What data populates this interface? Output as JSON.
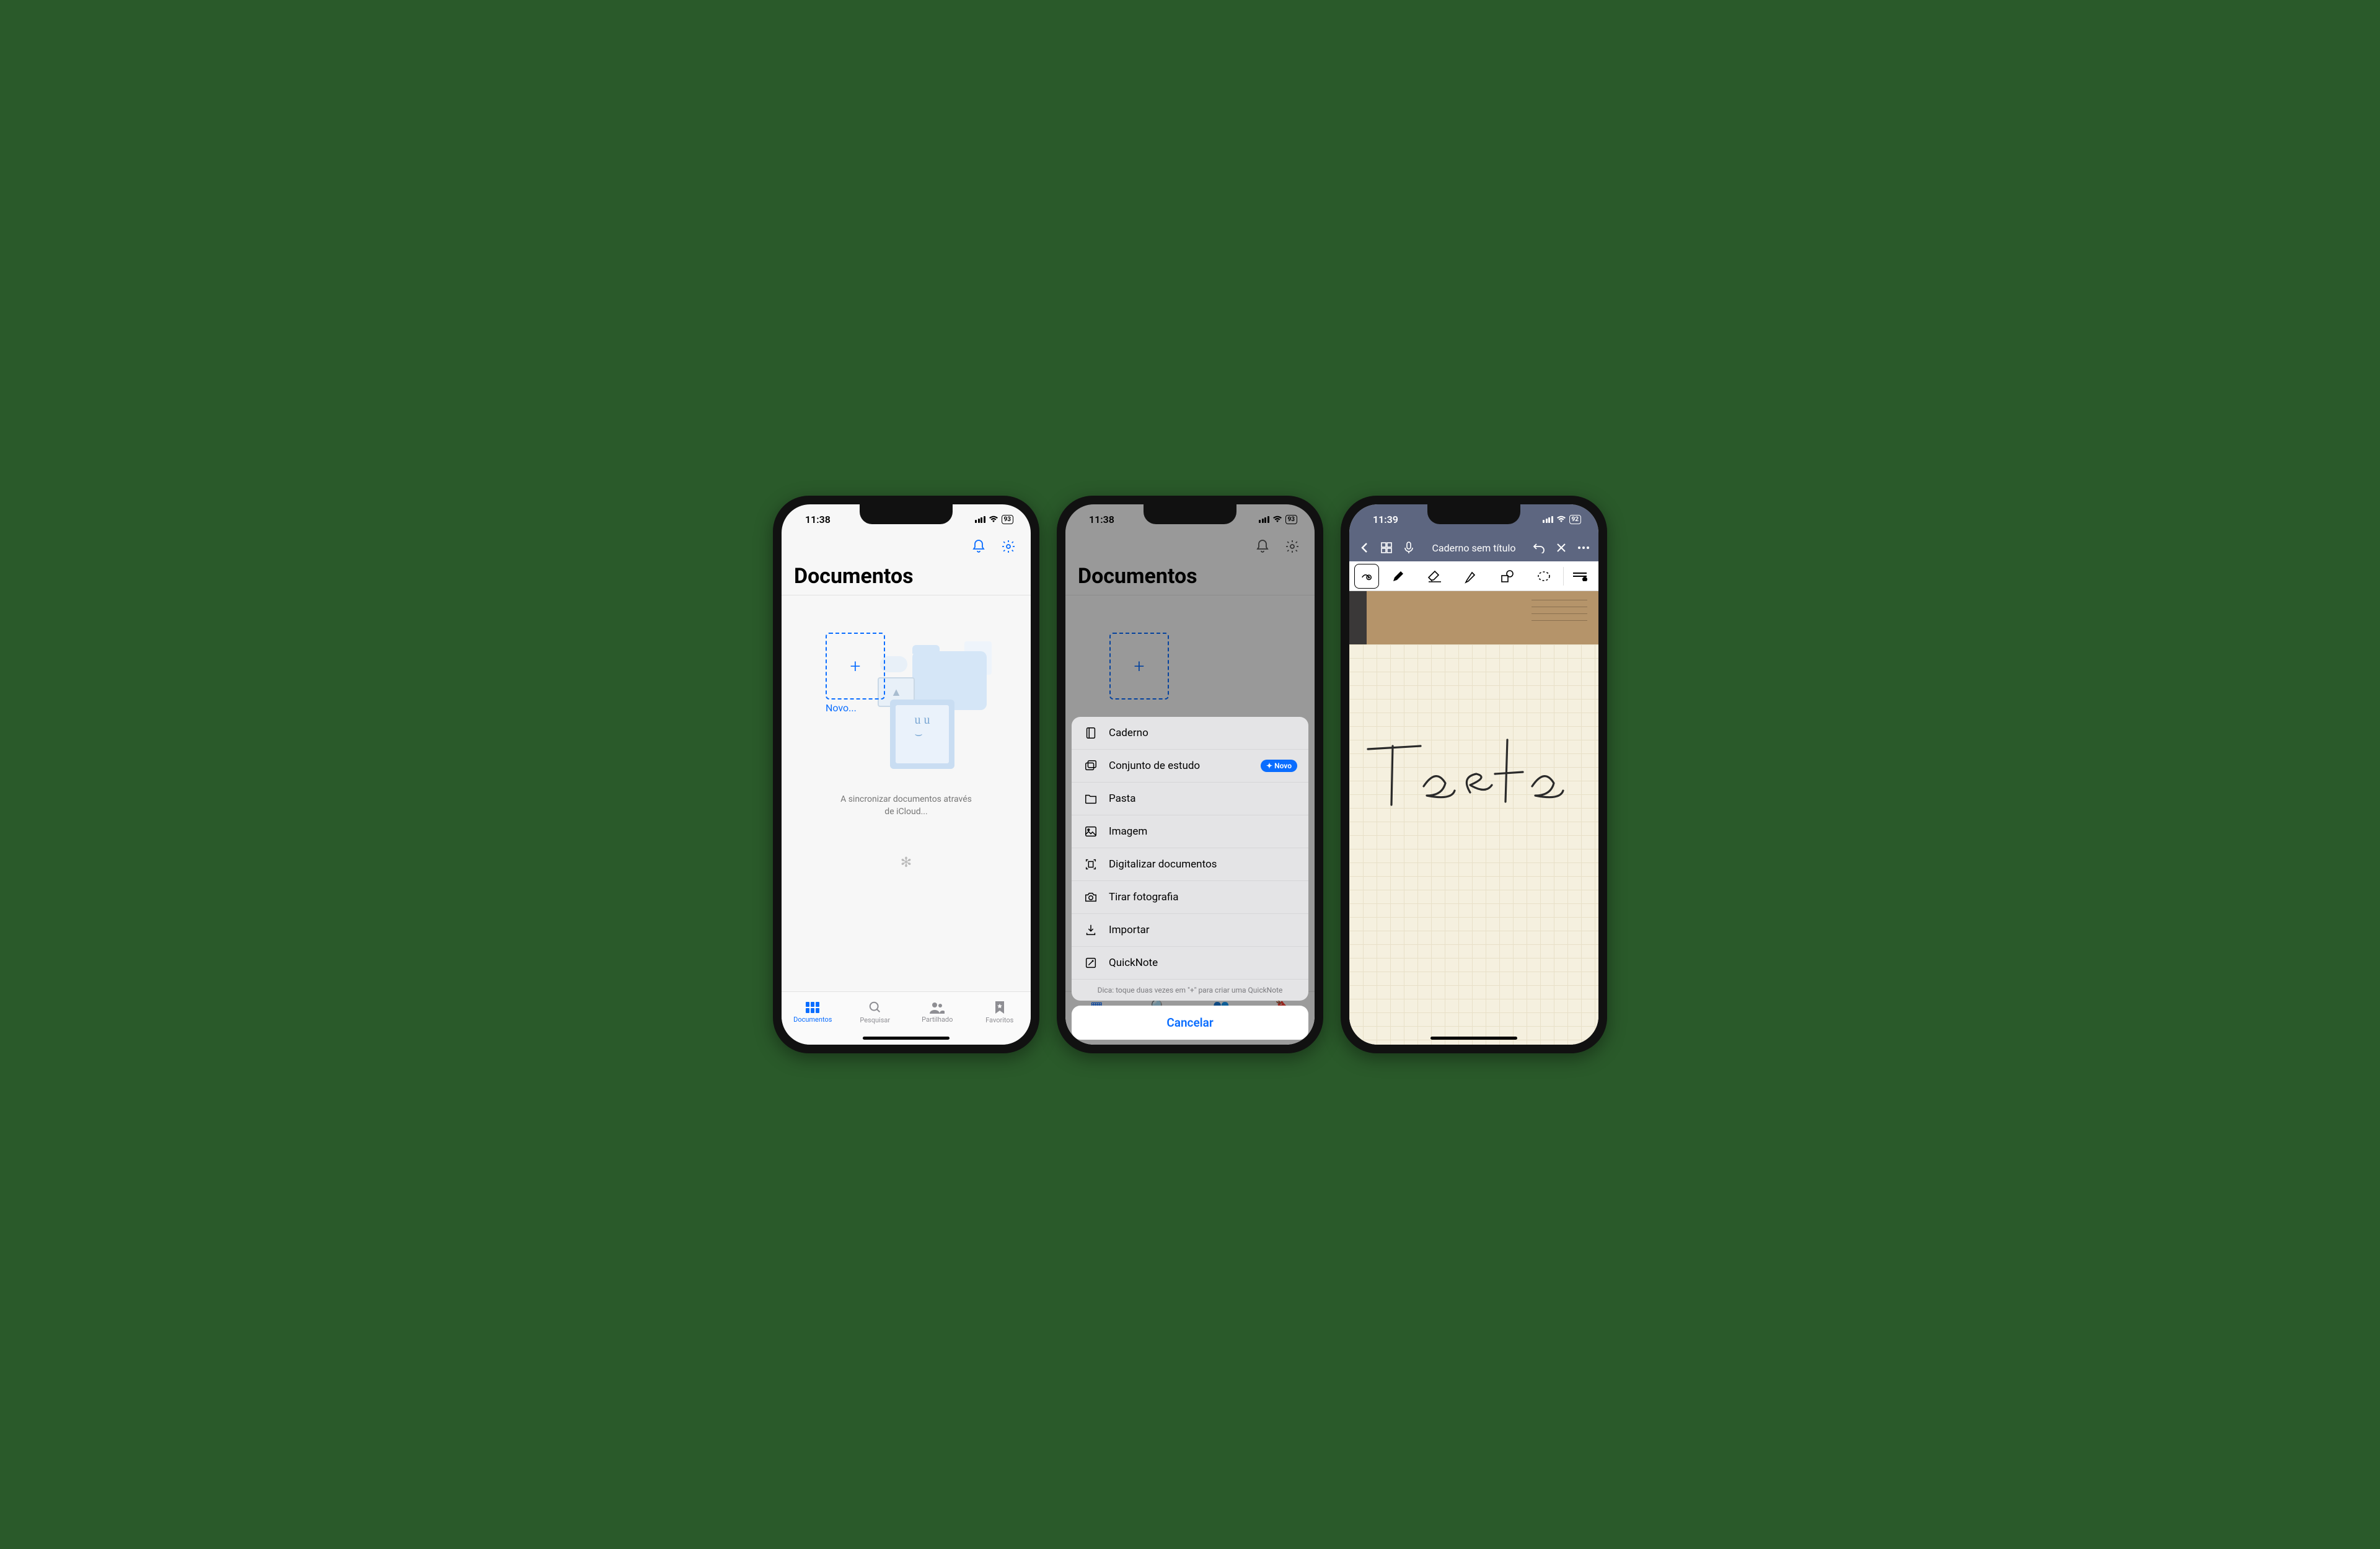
{
  "screen1": {
    "status": {
      "time": "11:38",
      "battery": "93"
    },
    "title": "Documentos",
    "new_label": "Novo...",
    "sync_text": "A sincronizar documentos através de iCloud...",
    "tabs": [
      {
        "label": "Documentos",
        "icon": "grid"
      },
      {
        "label": "Pesquisar",
        "icon": "search"
      },
      {
        "label": "Partilhado",
        "icon": "people"
      },
      {
        "label": "Favoritos",
        "icon": "bookmark"
      }
    ]
  },
  "screen2": {
    "status": {
      "time": "11:38",
      "battery": "93"
    },
    "title": "Documentos",
    "menu": [
      {
        "icon": "notebook",
        "label": "Caderno"
      },
      {
        "icon": "stack",
        "label": "Conjunto de estudo",
        "badge": "Novo"
      },
      {
        "icon": "folder",
        "label": "Pasta"
      },
      {
        "icon": "image",
        "label": "Imagem"
      },
      {
        "icon": "scan",
        "label": "Digitalizar documentos"
      },
      {
        "icon": "camera",
        "label": "Tirar fotografia"
      },
      {
        "icon": "import",
        "label": "Importar"
      },
      {
        "icon": "quicknote",
        "label": "QuickNote"
      }
    ],
    "tip": "Dica: toque duas vezes em \"+\" para criar uma QuickNote",
    "cancel": "Cancelar"
  },
  "screen3": {
    "status": {
      "time": "11:39",
      "battery": "92"
    },
    "title": "Caderno sem título",
    "handwriting": "Teste"
  }
}
